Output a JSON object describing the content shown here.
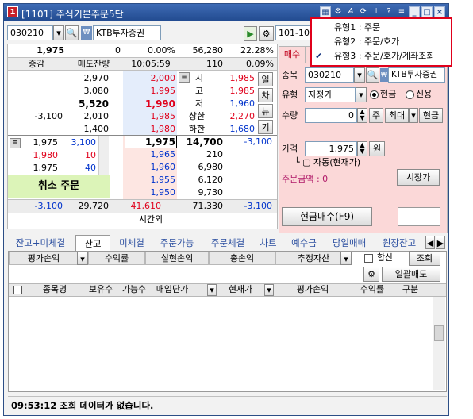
{
  "window": {
    "title": "[1101] 주식기본주문5단",
    "icon_label": "1"
  },
  "popup": {
    "items": [
      {
        "label": "유형1 : 주문",
        "checked": false
      },
      {
        "label": "유형2 : 주문/호가",
        "checked": false
      },
      {
        "label": "유형3 : 주문/호가/계좌조회",
        "checked": true
      }
    ]
  },
  "header": {
    "stock_code": "030210",
    "stock_name": "KTB투자증권",
    "account": "101-10-"
  },
  "quote": {
    "price": "1,975",
    "change": "0",
    "change_rate": "0.00%",
    "volume": "56,280",
    "turnover_rate": "22.28%",
    "col_change": "증감",
    "col_ask_qty": "매도잔량",
    "time": "10:05:59",
    "vol_power": "110",
    "vol_power_rate": "0.09%",
    "asks": [
      {
        "qty": "2,970",
        "price": "2,000",
        "rate": "",
        "info_label": "시",
        "info_value": "1,985"
      },
      {
        "qty": "3,080",
        "price": "1,995",
        "rate": "",
        "info_label": "고",
        "info_value": "1,985"
      },
      {
        "qty": "5,520",
        "price": "1,990",
        "rate": "",
        "info_label": "저",
        "info_value": "1,960"
      },
      {
        "qty": "2,010",
        "price": "1,985",
        "rate": "",
        "info_label": "상한",
        "info_value": "2,270",
        "change": "-3,100"
      },
      {
        "qty": "1,400",
        "price": "1,980",
        "rate": "",
        "info_label": "하한",
        "info_value": "1,680"
      }
    ],
    "side_buttons": [
      "일",
      "차",
      "뉴",
      "기"
    ],
    "trades": [
      {
        "price": "1,975",
        "qty": "3,100"
      },
      {
        "price": "1,980",
        "qty": "10"
      },
      {
        "price": "1,975",
        "qty": "40"
      }
    ],
    "cur_price": "1,975",
    "cur_qty": "14,700",
    "cur_change": "-3,100",
    "bids": [
      {
        "price": "1,965",
        "qty": "210"
      },
      {
        "price": "1,960",
        "qty": "6,980"
      },
      {
        "price": "1,955",
        "qty": "6,120"
      },
      {
        "price": "1,950",
        "qty": "9,730"
      }
    ],
    "cancel_order": "취소 주문",
    "total_change_left": "-3,100",
    "total_ask": "29,720",
    "total_price": "41,610",
    "total_bid": "71,330",
    "total_change_right": "-3,100",
    "after_hours": "시간외"
  },
  "order": {
    "tab_buy": "매수",
    "label_code": "종목",
    "code": "030210",
    "name": "KTB투자증권",
    "label_type": "유형",
    "type_value": "지정가",
    "radio_cash": "현금",
    "radio_credit": "신용",
    "label_qty": "수량",
    "qty": "0",
    "btn_ju": "주",
    "btn_max": "최대",
    "btn_cash": "현금",
    "label_price": "가격",
    "price": "1,975",
    "won": "원",
    "auto_label": "└ ▢ 자동(현재가)",
    "amount_label": "주문금액 : 0",
    "market_btn": "시장가",
    "submit": "현금매수(F9)"
  },
  "tabs": [
    "잔고+미체결",
    "잔고",
    "미체결",
    "주문가능",
    "주문체결",
    "차트",
    "예수금",
    "당일매매",
    "원장잔고"
  ],
  "summary": {
    "headers": [
      "평가손익",
      "수익률",
      "실현손익",
      "총손익",
      "추정자산"
    ],
    "sum_label": "합산",
    "query_btn": "조회",
    "bulk_sell": "일괄매도"
  },
  "table": {
    "headers": [
      "종목명",
      "보유수",
      "가능수",
      "매입단가",
      "현재가",
      "평가손익",
      "수익률",
      "구분"
    ]
  },
  "status": {
    "message": "09:53:12 조회 데이터가 없습니다."
  }
}
